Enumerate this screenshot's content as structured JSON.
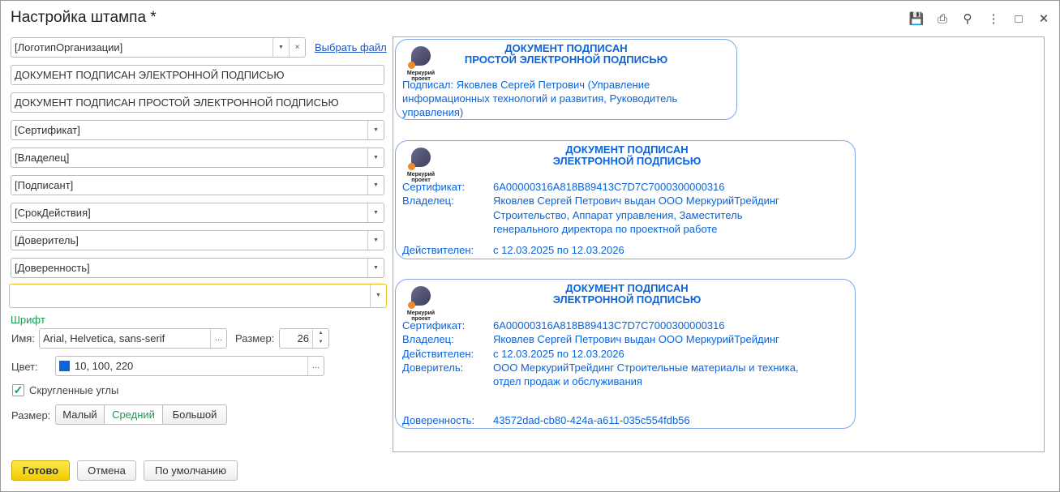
{
  "window": {
    "title": "Настройка штампа *"
  },
  "toolbar": {
    "icons": [
      "save-icon",
      "print-icon",
      "preview-icon",
      "more-icon",
      "maximize-icon",
      "close-icon"
    ]
  },
  "form": {
    "logo_field": "[ЛоготипОрганизации]",
    "choose_file": "Выбрать файл",
    "header_text": "ДОКУМЕНТ ПОДПИСАН ЭЛЕКТРОННОЙ ПОДПИСЬЮ",
    "header_simple_text": "ДОКУМЕНТ ПОДПИСАН ПРОСТОЙ ЭЛЕКТРОННОЙ ПОДПИСЬЮ",
    "fields": [
      "[Сертификат]",
      "[Владелец]",
      "[Подписант]",
      "[СрокДействия]",
      "[Доверитель]",
      "[Доверенность]",
      ""
    ],
    "font_section": "Шрифт",
    "font_name_label": "Имя:",
    "font_name": "Arial, Helvetica, sans-serif",
    "size_label": "Размер:",
    "size_value": "26",
    "color_label": "Цвет:",
    "color_value": "10, 100, 220",
    "color_hex": "#0a64dc",
    "rounded_label": "Скругленные углы",
    "rounded_checked": true,
    "stamp_size_label": "Размер:",
    "sizes": [
      "Малый",
      "Средний",
      "Большой"
    ],
    "selected_size": "Средний"
  },
  "buttons": {
    "done": "Готово",
    "cancel": "Отмена",
    "default": "По умолчанию"
  },
  "preview": {
    "logo_text": "Меркурий проект",
    "stamp1": {
      "h1": "ДОКУМЕНТ ПОДПИСАН",
      "h2": "ПРОСТОЙ ЭЛЕКТРОННОЙ ПОДПИСЬЮ",
      "l1": "Подписал: Яковлев Сергей Петрович (Управление",
      "l2": "информационных технологий и развития, Руководитель",
      "l3": "управления)"
    },
    "stamp2": {
      "h1": "ДОКУМЕНТ ПОДПИСАН",
      "h2": "ЭЛЕКТРОННОЙ ПОДПИСЬЮ",
      "cert_k": "Сертификат:",
      "cert_v": "6A00000316A818B89413C7D7C7000300000316",
      "own_k": "Владелец:",
      "own_v1": "Яковлев Сергей Петрович выдан ООО МеркурийТрейдинг",
      "own_v2": "Строительство, Аппарат управления, Заместитель",
      "own_v3": "генерального директора по проектной работе",
      "valid_k": "Действителен:",
      "valid_v": "с 12.03.2025 по 12.03.2026"
    },
    "stamp3": {
      "h1": "ДОКУМЕНТ ПОДПИСАН",
      "h2": "ЭЛЕКТРОННОЙ ПОДПИСЬЮ",
      "cert_k": "Сертификат:",
      "cert_v": "6A00000316A818B89413C7D7C7000300000316",
      "own_k": "Владелец:",
      "own_v": "Яковлев Сергей Петрович выдан ООО МеркурийТрейдинг",
      "valid_k": "Действителен:",
      "valid_v": "с 12.03.2025 по 12.03.2026",
      "pr_k": "Доверитель:",
      "pr_v1": "ООО МеркурийТрейдинг Строительные материалы и техника,",
      "pr_v2": "отдел продаж и обслуживания",
      "poa_k": "Доверенность:",
      "poa_v": "43572dad-cb80-424a-a611-035c554fdb56"
    }
  }
}
